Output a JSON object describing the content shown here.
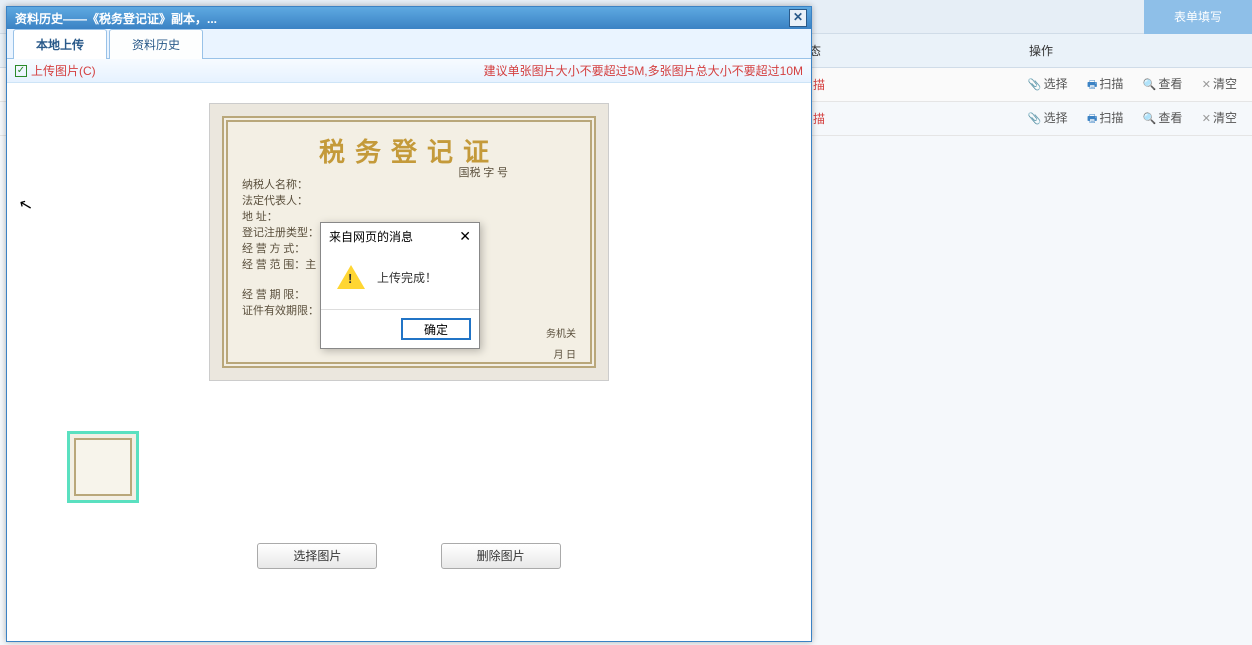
{
  "window": {
    "title": "资料历史——《税务登记证》副本，...",
    "close_title": "关闭"
  },
  "tabs": {
    "local_upload": "本地上传",
    "history": "资料历史"
  },
  "toolbar": {
    "upload_label": "上传图片(C)",
    "hint": "建议单张图片大小不要超过5M,多张图片总大小不要超过10M"
  },
  "certificate": {
    "title": "税务登记证",
    "lines": {
      "l1": "纳税人名称：",
      "l2": "法定代表人：",
      "l3": "地    址：",
      "l4": "登记注册类型：",
      "l5": "经 营 方 式：",
      "l6": "经 营 范 围：主",
      "l7": "经 营 期 限：",
      "l8": "证件有效期限："
    },
    "stamp": "国税    字            号",
    "footer_authority": "务机关",
    "footer_date": "月    日"
  },
  "buttons": {
    "select_image": "选择图片",
    "delete_image": "删除图片"
  },
  "alert": {
    "title": "来自网页的消息",
    "message": "上传完成！",
    "ok": "确定"
  },
  "bg": {
    "form_fill": "表单填写",
    "col_status": "态",
    "col_op": "操作",
    "row_status": "描",
    "ops": {
      "select": "选择",
      "scan": "扫描",
      "view": "查看",
      "clear": "清空"
    }
  }
}
